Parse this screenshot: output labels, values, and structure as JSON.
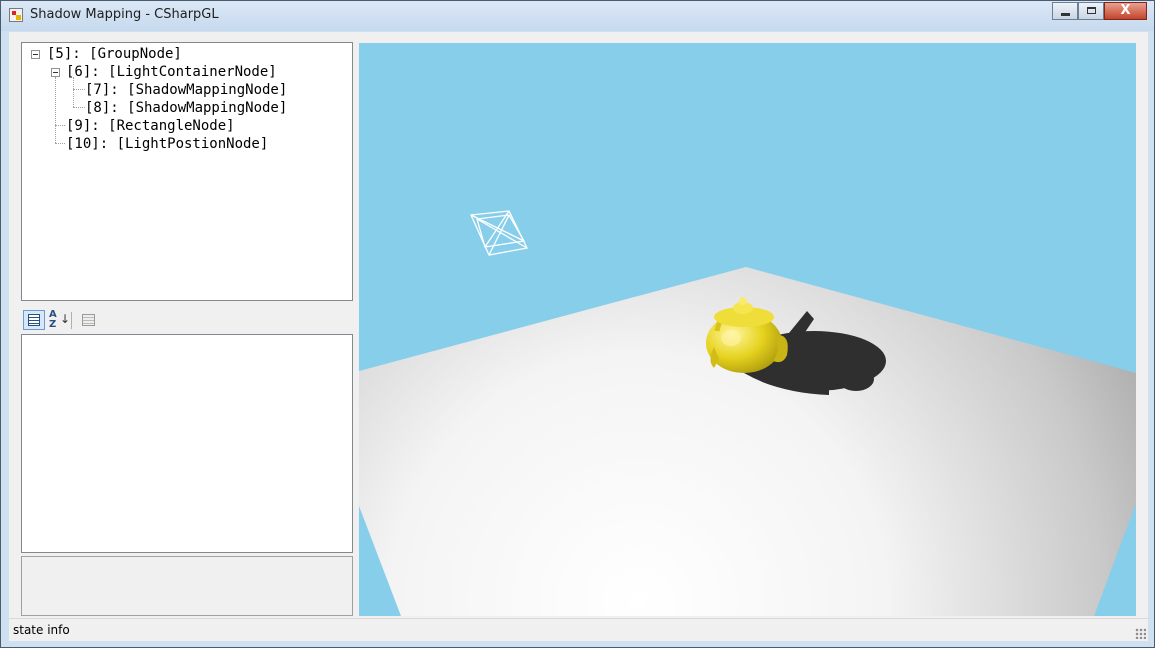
{
  "window": {
    "title": "Shadow Mapping - CSharpGL",
    "minimize_glyph": "",
    "maximize_glyph": "",
    "close_glyph": "X"
  },
  "scene_tree": {
    "nodes": [
      {
        "label": "[5]: [GroupNode]",
        "depth": 0,
        "expanded": true
      },
      {
        "label": "[6]: [LightContainerNode]",
        "depth": 1,
        "expanded": true
      },
      {
        "label": "[7]: [ShadowMappingNode]",
        "depth": 2
      },
      {
        "label": "[8]: [ShadowMappingNode]",
        "depth": 2
      },
      {
        "label": "[9]: [RectangleNode]",
        "depth": 1
      },
      {
        "label": "[10]: [LightPostionNode]",
        "depth": 1
      }
    ]
  },
  "property_toolbar": {
    "categorized_icon": "categorized-icon",
    "alphabetical_icon": "sort-az-icon",
    "alphabetical_glyph": "A\nZ",
    "property_pages_icon": "property-pages-icon"
  },
  "viewport": {
    "background_color": "#87ceea",
    "teapot_color": "#e6d21e",
    "shadow_color": "#2f2f2f"
  },
  "status": {
    "text": "state info"
  }
}
